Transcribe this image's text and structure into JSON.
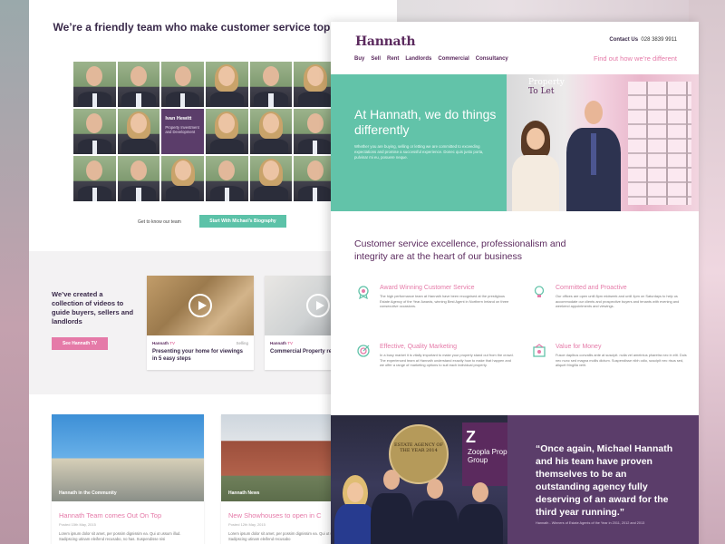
{
  "left": {
    "heading": "We’re a friendly team who make customer service top priority.",
    "featured_member": {
      "name": "Ivan Hewitt",
      "role": "Property Investment and Development"
    },
    "get_to_know": "Get to know our team",
    "bio_button": "Start With Michael’s Biography",
    "videos_text": "We’ve created a collection of videos to guide buyers, sellers and landlords",
    "tv_button": "See Hannath TV",
    "video_cards": [
      {
        "brand": "Hannath",
        "brand_badge": "TV",
        "tag": "Selling",
        "title": "Presenting your home for viewings in 5 easy steps"
      },
      {
        "brand": "Hannath",
        "brand_badge": "TV",
        "tag": "",
        "title": "Commercial Property re"
      }
    ],
    "news": [
      {
        "caption": "Hannath in the Community",
        "title": "Hannath Team comes Out On Top",
        "date": "Posted 15th May, 2015",
        "body": "Lorem ipsum dolor sit amet, per possim dignissim ea. Qui ut ussum illud. Sadipscing utinam eleifend recusabo, no has. Suspendisse nisi"
      },
      {
        "caption": "Hannath News",
        "title": "New Showhouses to open in C",
        "date": "Posted 12th May, 2015",
        "body": "Lorem ipsum dolor sit amet, per possim dignissim ea. Qui ut usum illud. Sadipscing utinam eleifend recusabo"
      }
    ]
  },
  "right": {
    "logo": "Hannath",
    "contact_label": "Contact Us",
    "phone": "028 3839 9911",
    "nav": [
      "Buy",
      "Sell",
      "Rent",
      "Landlords",
      "Commercial",
      "Consultancy"
    ],
    "find_link": "Find out how we’re different",
    "hero_title": "At Hannath, we do things differently",
    "hero_body": "Whether you are buying, selling or letting we are committed to exceeding expectations and promise a successful experience. Donec quis justo porta, pulvinar mi eu, posuere neque.",
    "sign_line1": "Property",
    "sign_line2": "To Let",
    "section_title": "Customer service excellence, professionalism and integrity are at the heart of our business",
    "features": [
      {
        "icon": "award-icon",
        "title": "Award Winning Customer Service",
        "body": "The high performance team at Hannath have been recognised at the prestigious Estate Agency of the Year Awards, winning Best Agent in Northern Ireland on three consecutive occasions."
      },
      {
        "icon": "lightbulb-icon",
        "title": "Committed and Proactive",
        "body": "Our offices are open until 8pm midweek and until 4pm on Saturdays to help us accommodate our clients and prospective buyers and tenants with evening and weekend appointments and viewings."
      },
      {
        "icon": "target-icon",
        "title": "Effective, Quality Marketing",
        "body": "In a busy market it is vitally important to make your property stand out from the crowd. The experienced team at Hannath understand exactly how to make that happen and we offer a range of marketing options to suit each individual property."
      },
      {
        "icon": "pound-tag-icon",
        "title": "Value for Money",
        "body": "Fusce dapibus convallis ante at suscipit. nulla vel ameintus pharetra nec in elit. Duis nec nunc sed magna mollis dictum. Suspendisse nibh odio, suscipit nec risus sed, aliquet fringilla velit."
      }
    ],
    "award_plaque": "ESTATE AGENCY OF THE YEAR 2014",
    "sponsor_initial": "Z",
    "sponsor_text": "Zoopla Prop Group",
    "quote": "“Once again, Michael Hannath and his team have proven themselves to be an outstanding agency fully deserving of an award for the third year running.”",
    "quote_source": "Hannath - Winners of Estate Agents of the Year in 2011, 2012 and 2013"
  },
  "colors": {
    "teal": "#62c3a9",
    "purple": "#5b3d6a",
    "pink": "#e57aa8"
  }
}
